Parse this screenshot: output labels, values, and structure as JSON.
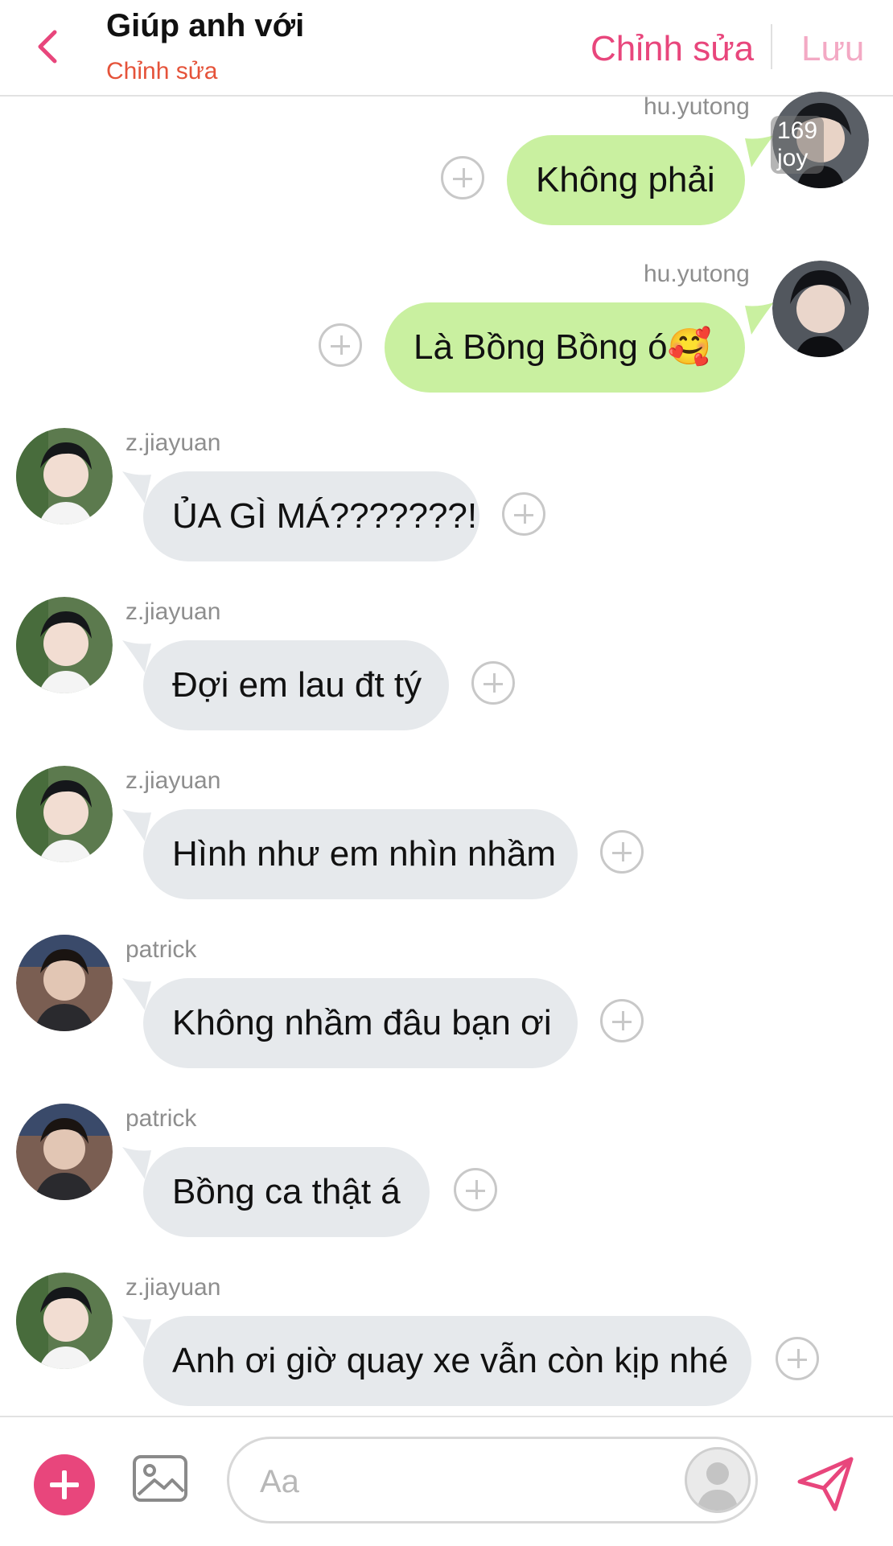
{
  "header": {
    "back_icon": "chevron-left-icon",
    "title": "Giúp anh với",
    "subtitle": "Chỉnh sửa",
    "edit_label": "Chỉnh sửa",
    "save_label": "Lưu",
    "accent_color": "#e8467c"
  },
  "watermark": "169 joy",
  "messages": [
    {
      "sender": "hu.yutong",
      "text": "Không phải",
      "direction": "outgoing"
    },
    {
      "sender": "hu.yutong",
      "text": "Là Bồng Bồng ó🥰",
      "direction": "outgoing"
    },
    {
      "sender": "z.jiayuan",
      "text": "ỦA GÌ MÁ???????!",
      "direction": "incoming"
    },
    {
      "sender": "z.jiayuan",
      "text": "Đợi em lau đt tý",
      "direction": "incoming"
    },
    {
      "sender": "z.jiayuan",
      "text": "Hình như em nhìn nhầm",
      "direction": "incoming"
    },
    {
      "sender": "patrick",
      "text": "Không nhầm đâu bạn ơi",
      "direction": "incoming"
    },
    {
      "sender": "patrick",
      "text": "Bồng ca thật á",
      "direction": "incoming"
    },
    {
      "sender": "z.jiayuan",
      "text": "Anh ơi giờ quay xe vẫn còn kịp nhé",
      "direction": "incoming"
    }
  ],
  "composer": {
    "placeholder": "Aa",
    "add_icon": "plus-icon",
    "image_icon": "image-icon",
    "send_icon": "send-icon"
  },
  "colors": {
    "outgoing_bubble": "#c9f0a0",
    "incoming_bubble": "#e6e9ec"
  }
}
